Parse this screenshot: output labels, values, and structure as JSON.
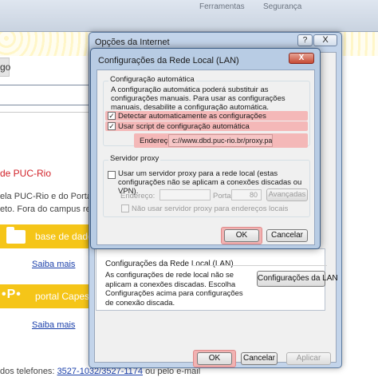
{
  "background_page": {
    "browser_tools": [
      "Ferramentas",
      "Segurança"
    ],
    "tab_fragment": "go",
    "puc_title": "de PUC-Rio",
    "desc_line1": "ela PUC-Rio e do Portal C",
    "desc_line2": "eto. Fora do campus requ",
    "band1_label": "base de dados",
    "band2_label": "portal Capes",
    "link1": "Saiba mais",
    "link2": "Saiba mais",
    "footer_text": "dos telefones: ",
    "footer_phone": "3527-1032/3527-1174",
    "footer_tail": " ou pelo e-mail",
    "colors": {
      "band": "#f5c518",
      "puc_red": "#d2232a",
      "link": "#1a3faa"
    }
  },
  "internet_options": {
    "title": "Opções da Internet",
    "help_label": "?",
    "close_label": "X",
    "lan_group_title": "Configurações da Rede Local (LAN)",
    "lan_group_text": "As configurações de rede local não se aplicam a conexões discadas. Escolha Configurações acima para configurações de conexão discada.",
    "lan_button": "Configurações da LAN",
    "ok_button": "OK",
    "cancel_button": "Cancelar",
    "apply_button": "Aplicar"
  },
  "lan_settings": {
    "title": "Configurações da Rede Local (LAN)",
    "close_label": "X",
    "auto_config": {
      "group_title": "Configuração automática",
      "description": "A configuração automática poderá substituir as configurações manuais. Para usar as configurações manuais, desabilite a configuração automática.",
      "detect_label": "Detectar automaticamente as configurações",
      "detect_checked": "✓",
      "script_label": "Usar script de configuração automática",
      "script_checked": "✓",
      "address_label": "Endereço",
      "address_value": "c://www.dbd.puc-rio.br/proxy.pac"
    },
    "proxy": {
      "group_title": "Servidor proxy",
      "use_proxy_label": "Usar um servidor proxy para a rede local (estas configurações não se aplicam a conexões discadas ou VPN).",
      "address_label": "Endereço:",
      "port_label": "Porta:",
      "port_value": "80",
      "advanced_button": "Avançadas",
      "bypass_label": "Não usar servidor proxy para endereços locais"
    },
    "ok_button": "OK",
    "cancel_button": "Cancelar",
    "highlight_color": "#f4b8b8"
  }
}
